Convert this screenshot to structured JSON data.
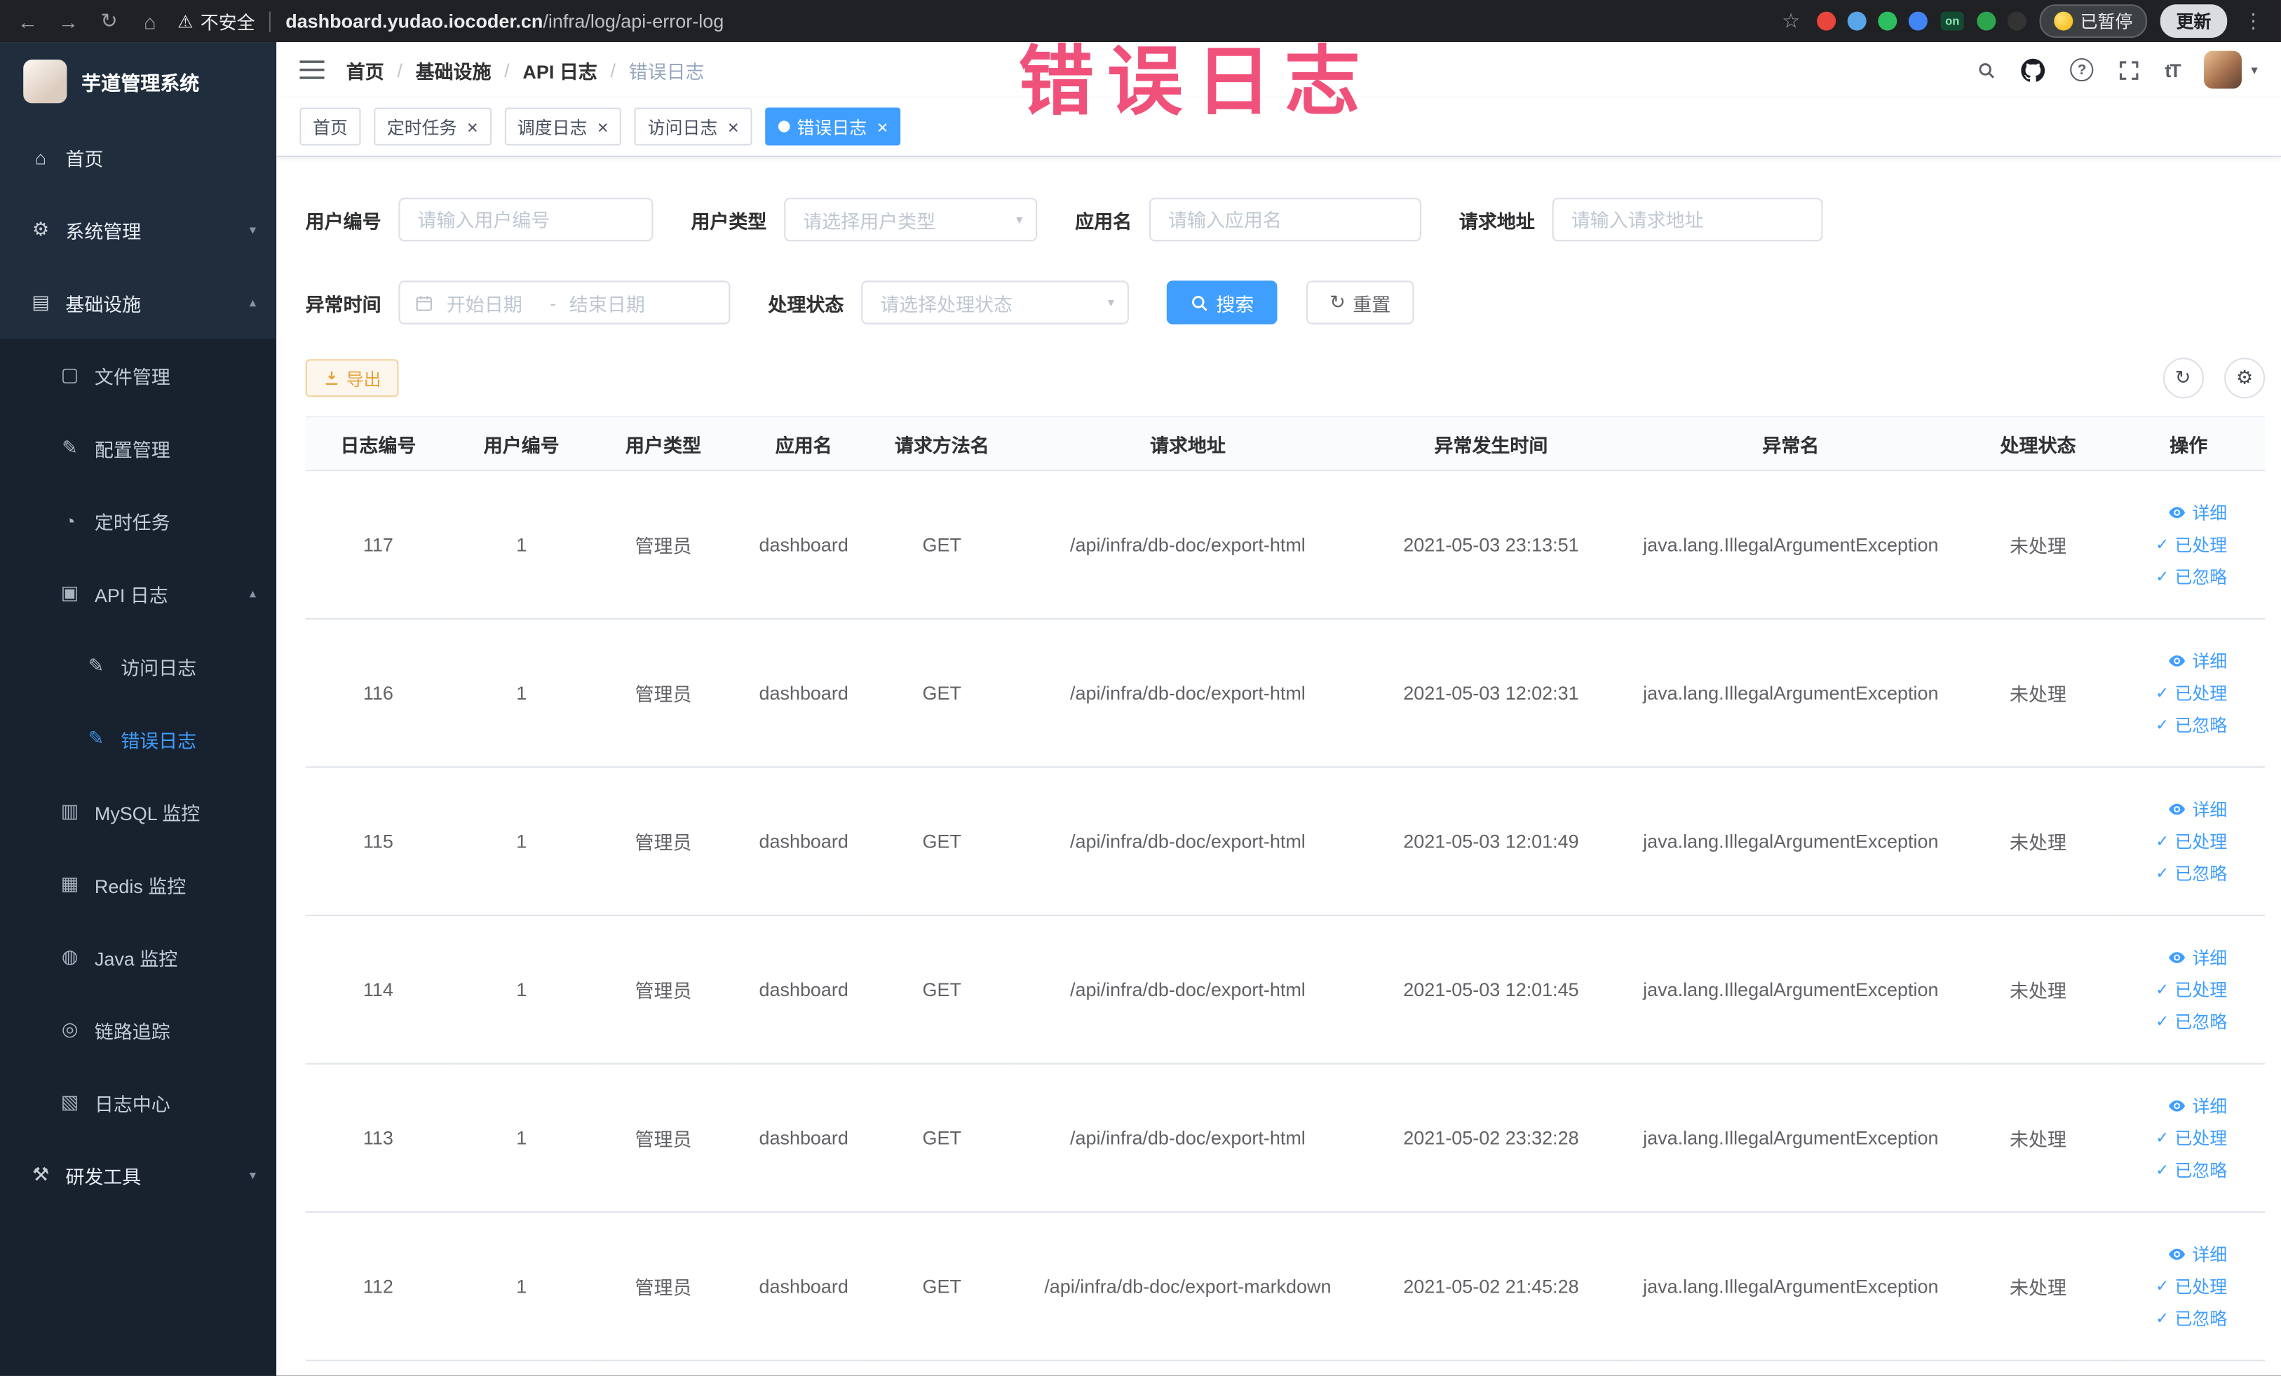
{
  "browser": {
    "security_label": "不安全",
    "url_host": "dashboard.yudao.iocoder.cn",
    "url_path": "/infra/log/api-error-log",
    "on_badge": "on",
    "paused_badge": "已暂停",
    "update_button": "更新",
    "extension_colors": [
      "#e8453c",
      "#58a6e8",
      "#2dbe60",
      "#4285f4",
      "#2da44e",
      "#333333"
    ]
  },
  "annotation": {
    "text": "错误日志",
    "color": "#f0517b"
  },
  "sidebar": {
    "logo_title": "芋道管理系统",
    "items": [
      {
        "label": "首页",
        "icon": "home-icon",
        "level": 1
      },
      {
        "label": "系统管理",
        "icon": "gear-icon",
        "level": 1,
        "chevron": "down"
      },
      {
        "label": "基础设施",
        "icon": "infrastructure-icon",
        "level": 1,
        "chevron": "up"
      },
      {
        "label": "文件管理",
        "icon": "file-icon",
        "level": 2
      },
      {
        "label": "配置管理",
        "icon": "config-icon",
        "level": 2
      },
      {
        "label": "定时任务",
        "icon": "timer-icon",
        "level": 2
      },
      {
        "label": "API 日志",
        "icon": "api-log-icon",
        "level": 2,
        "chevron": "up"
      },
      {
        "label": "访问日志",
        "icon": "doc-edit-icon",
        "level": 3
      },
      {
        "label": "错误日志",
        "icon": "doc-edit-icon",
        "level": 3,
        "active": true
      },
      {
        "label": "MySQL 监控",
        "icon": "mysql-icon",
        "level": 2
      },
      {
        "label": "Redis 监控",
        "icon": "redis-icon",
        "level": 2
      },
      {
        "label": "Java 监控",
        "icon": "java-icon",
        "level": 2
      },
      {
        "label": "链路追踪",
        "icon": "trace-icon",
        "level": 2
      },
      {
        "label": "日志中心",
        "icon": "log-center-icon",
        "level": 2
      },
      {
        "label": "研发工具",
        "icon": "tools-icon",
        "level": 1,
        "chevron": "down",
        "dark": true
      }
    ]
  },
  "header": {
    "breadcrumb": [
      "首页",
      "基础设施",
      "API 日志",
      "错误日志"
    ],
    "separator": "/"
  },
  "tabs": [
    {
      "label": "首页",
      "closable": false,
      "active": false
    },
    {
      "label": "定时任务",
      "closable": true,
      "active": false
    },
    {
      "label": "调度日志",
      "closable": true,
      "active": false
    },
    {
      "label": "访问日志",
      "closable": true,
      "active": false
    },
    {
      "label": "错误日志",
      "closable": true,
      "active": true
    }
  ],
  "filters": {
    "fields": [
      {
        "label": "用户编号",
        "placeholder": "请输入用户编号",
        "type": "input"
      },
      {
        "label": "用户类型",
        "placeholder": "请选择用户类型",
        "type": "select"
      },
      {
        "label": "应用名",
        "placeholder": "请输入应用名",
        "type": "input"
      },
      {
        "label": "请求地址",
        "placeholder": "请输入请求地址",
        "type": "input"
      },
      {
        "label": "异常时间",
        "type": "daterange",
        "start_placeholder": "开始日期",
        "separator": "-",
        "end_placeholder": "结束日期"
      },
      {
        "label": "处理状态",
        "placeholder": "请选择处理状态",
        "type": "select"
      }
    ],
    "search_label": "搜索",
    "reset_label": "重置"
  },
  "toolbar": {
    "export_label": "导出"
  },
  "table": {
    "columns": [
      "日志编号",
      "用户编号",
      "用户类型",
      "应用名",
      "请求方法名",
      "请求地址",
      "异常发生时间",
      "异常名",
      "处理状态",
      "操作"
    ],
    "rows": [
      [
        "117",
        "1",
        "管理员",
        "dashboard",
        "GET",
        "/api/infra/db-doc/export-html",
        "2021-05-03 23:13:51",
        "java.lang.IllegalArgumentException",
        "未处理"
      ],
      [
        "116",
        "1",
        "管理员",
        "dashboard",
        "GET",
        "/api/infra/db-doc/export-html",
        "2021-05-03 12:02:31",
        "java.lang.IllegalArgumentException",
        "未处理"
      ],
      [
        "115",
        "1",
        "管理员",
        "dashboard",
        "GET",
        "/api/infra/db-doc/export-html",
        "2021-05-03 12:01:49",
        "java.lang.IllegalArgumentException",
        "未处理"
      ],
      [
        "114",
        "1",
        "管理员",
        "dashboard",
        "GET",
        "/api/infra/db-doc/export-html",
        "2021-05-03 12:01:45",
        "java.lang.IllegalArgumentException",
        "未处理"
      ],
      [
        "113",
        "1",
        "管理员",
        "dashboard",
        "GET",
        "/api/infra/db-doc/export-html",
        "2021-05-02 23:32:28",
        "java.lang.IllegalArgumentException",
        "未处理"
      ],
      [
        "112",
        "1",
        "管理员",
        "dashboard",
        "GET",
        "/api/infra/db-doc/export-markdown",
        "2021-05-02 21:45:28",
        "java.lang.IllegalArgumentException",
        "未处理"
      ]
    ],
    "row_actions": [
      {
        "label": "详细",
        "icon": "eye-icon"
      },
      {
        "label": "已处理",
        "icon": "check-icon"
      },
      {
        "label": "已忽略",
        "icon": "check-icon"
      }
    ]
  },
  "colors": {
    "accent": "#409eff",
    "warning": "#e6a23c",
    "sidebar_dark": "#18222f",
    "sidebar_item": "#1f2d3c"
  },
  "icons": {
    "back-icon": "←",
    "forward-icon": "→",
    "reload-icon": "↻",
    "browser-home-icon": "⌂",
    "warning-icon": "⚠",
    "star-icon": "☆",
    "more-icon": "⋮",
    "home-icon": "⌂",
    "gear-icon": "⚙",
    "infrastructure-icon": "▤",
    "file-icon": "▢",
    "config-icon": "✎",
    "timer-icon": "◔",
    "api-log-icon": "▣",
    "doc-edit-icon": "✎",
    "mysql-icon": "▥",
    "redis-icon": "▦",
    "java-icon": "◍",
    "trace-icon": "◎",
    "log-center-icon": "▧",
    "tools-icon": "⚒",
    "chevron-down-icon": "▾",
    "chevron-up-icon": "▴",
    "caret-down-icon": "▾",
    "select-arrow-icon": "▾",
    "check-icon": "✓",
    "close-icon": "×",
    "refresh-icon": "↻",
    "settings-icon": "⚙",
    "question-icon": "?",
    "font-size-icon": "tT"
  }
}
